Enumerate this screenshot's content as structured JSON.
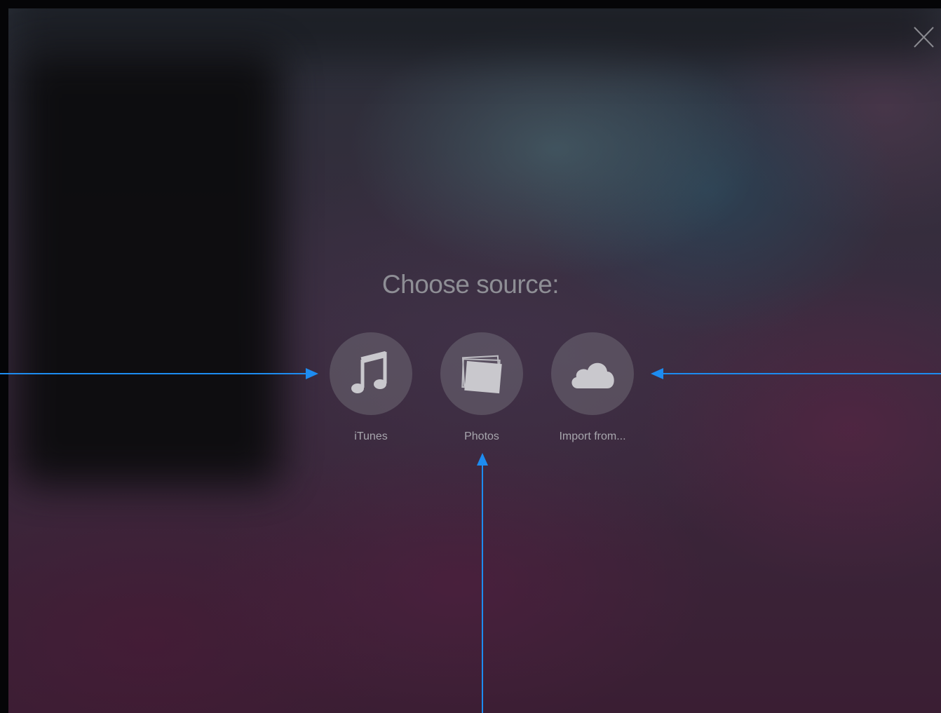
{
  "dialog": {
    "title": "Choose source:",
    "close_icon": "close-icon"
  },
  "sources": [
    {
      "label": "iTunes",
      "icon": "music-note-icon"
    },
    {
      "label": "Photos",
      "icon": "photos-stack-icon"
    },
    {
      "label": "Import from...",
      "icon": "cloud-icon"
    }
  ],
  "colors": {
    "annotation_arrow": "#1d8cf0",
    "icon_fill": "#c9c8cd",
    "label_text": "#a7a6ad",
    "title_text": "#8e8e95"
  }
}
